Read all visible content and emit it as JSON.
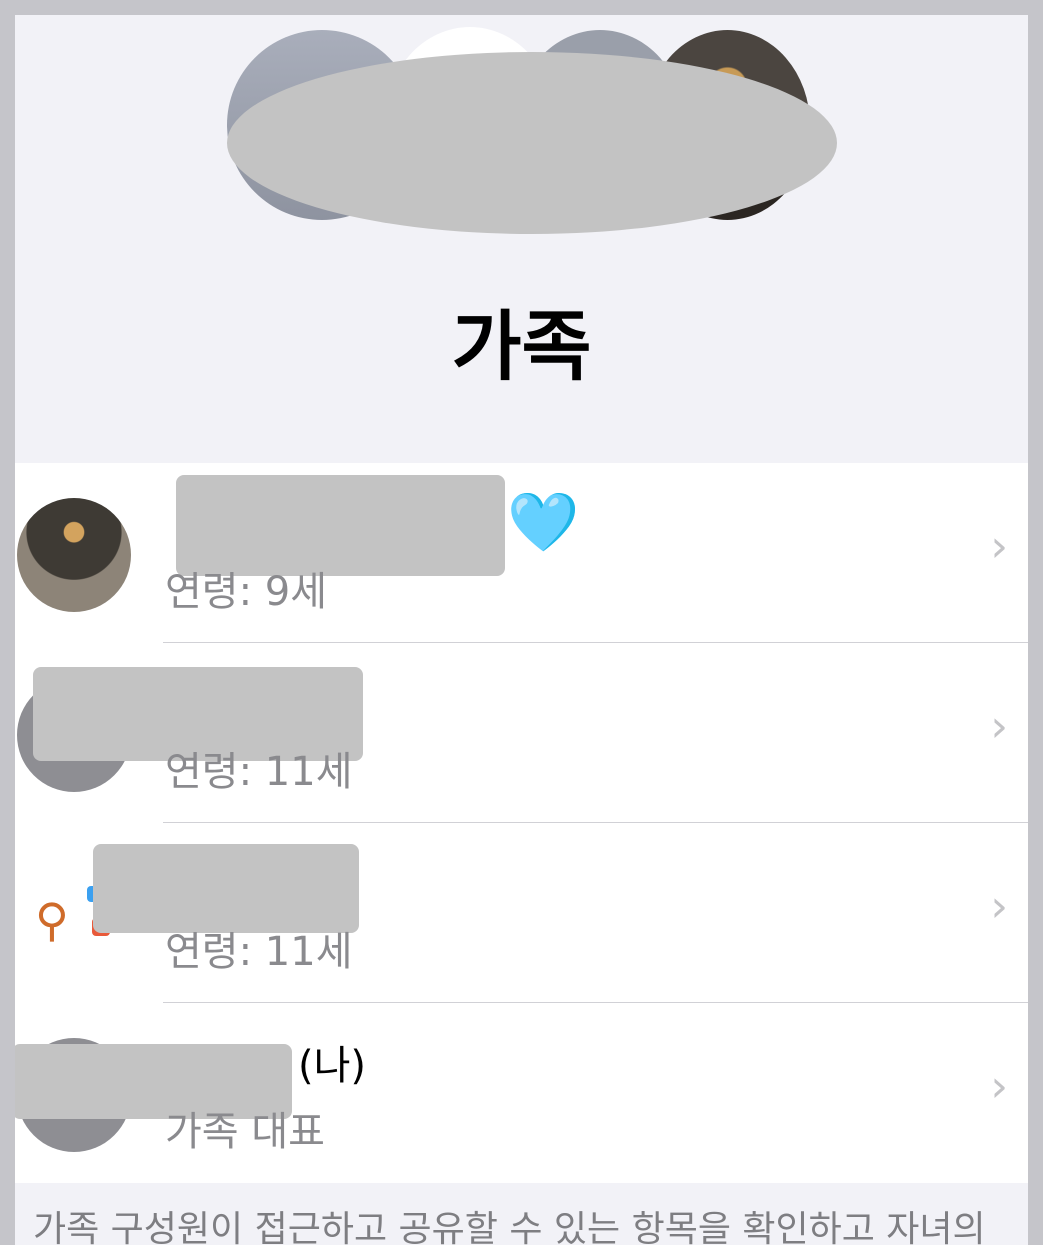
{
  "page": {
    "title": "가족"
  },
  "members": [
    {
      "name": "",
      "subtitle": "연령: 9세",
      "emoji": "🩵"
    },
    {
      "name": "",
      "subtitle": "연령: 11세"
    },
    {
      "name": "",
      "subtitle": "연령: 11세"
    },
    {
      "name": "(나)",
      "subtitle": "가족 대표"
    }
  ],
  "footer": {
    "text": "가족 구성원이 접근하고 공유할 수 있는 항목을 확인하고 자녀의"
  },
  "colors": {
    "background": "#f2f2f7",
    "redaction": "#c3c3c3",
    "secondary_text": "#8a8a8e",
    "heart": "#5ac8fa"
  },
  "icons": [
    "chevron-right-icon",
    "heart-icon"
  ]
}
